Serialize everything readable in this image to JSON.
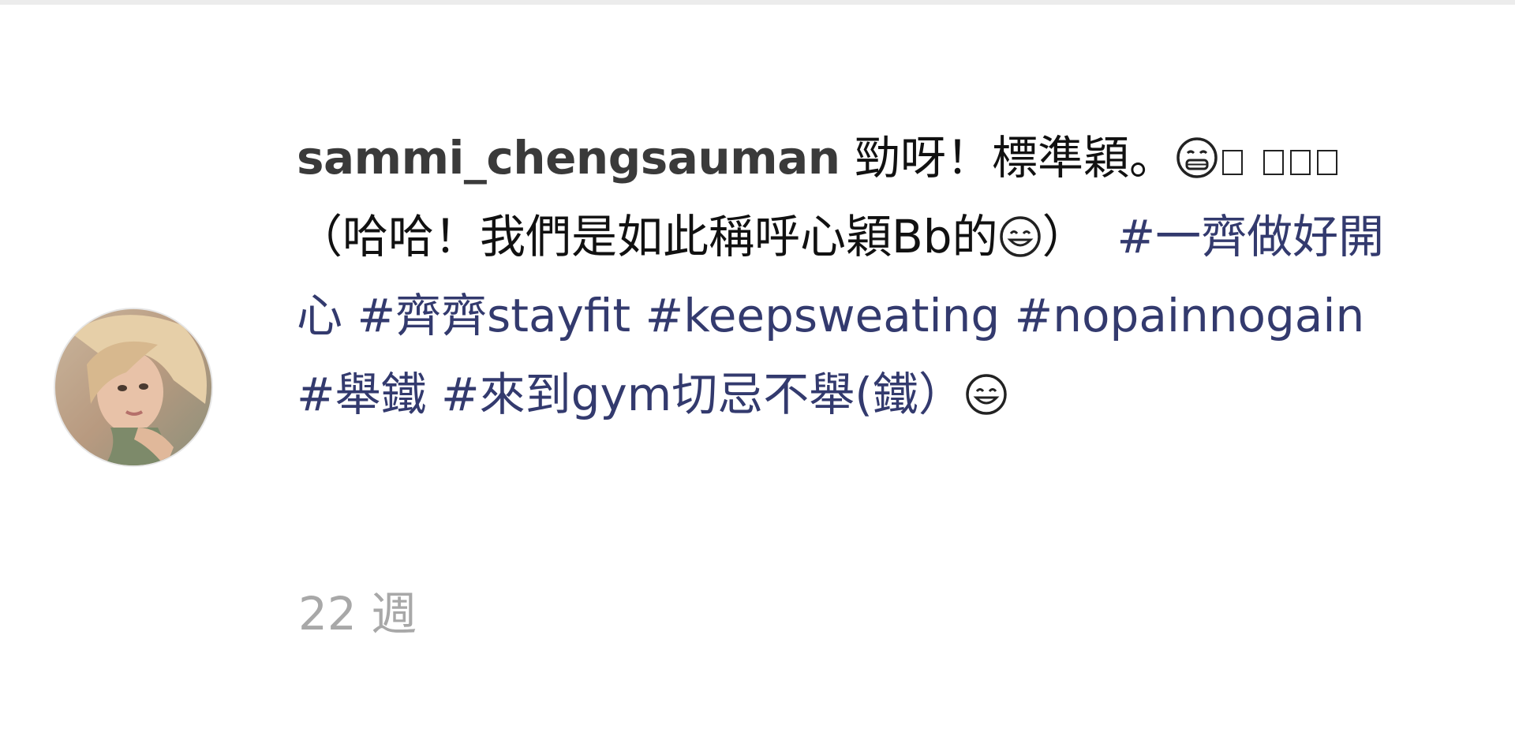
{
  "comment": {
    "username": "sammi_chengsauman",
    "text_line1": "勁呀！標準穎。",
    "text_paren_open": " （哈哈！我們是如此稱呼心穎Bb的",
    "text_paren_close": "）",
    "hashtags": [
      "#一齊做好開心",
      "#齊齊stayfit",
      "#keepsweating",
      "#nopainnogain",
      "#舉鐵",
      "#來到gym切忌不舉(鐵）"
    ],
    "timestamp": "22 週"
  },
  "icons": {
    "avatar": "profile-photo",
    "emoji_grin": "grinning-face-icon",
    "emoji_smile": "smiling-face-icon",
    "missing_glyph": "missing-glyph-box"
  }
}
